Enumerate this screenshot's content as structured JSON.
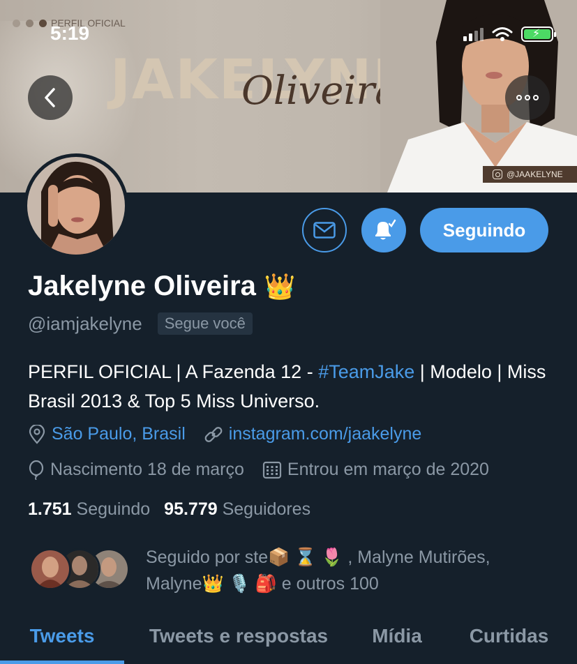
{
  "status_bar": {
    "time": "5:19"
  },
  "banner": {
    "overlay_label": "PERFIL OFICIAL",
    "title": "JAKELYNE",
    "script": "Oliveira",
    "instagram_tag": "@JAAKELYNE"
  },
  "actions": {
    "follow_label": "Seguindo"
  },
  "profile": {
    "name": "Jakelyne Oliveira",
    "name_emoji": "👑",
    "handle": "@iamjakelyne",
    "follows_you": "Segue você",
    "bio_part1": "PERFIL OFICIAL | A Fazenda 12 - ",
    "bio_hashtag": "#TeamJake",
    "bio_part2": " | Modelo | Miss Brasil 2013 & Top 5 Miss Universo.",
    "location": "São Paulo, Brasil",
    "website": "instagram.com/jaakelyne",
    "birthday": "Nascimento 18 de março",
    "joined": "Entrou em março de 2020"
  },
  "stats": {
    "following_count": "1.751",
    "following_label": "Seguindo",
    "followers_count": "95.779",
    "followers_label": "Seguidores"
  },
  "followed_by": {
    "line1": "Seguido por ste📦 ⌛ 🌷 , Malyne Mutirões,",
    "line2": "Malyne👑 🎙️ 🎒  e outros 100"
  },
  "tabs": [
    {
      "label": "Tweets"
    },
    {
      "label": "Tweets e respostas"
    },
    {
      "label": "Mídia"
    },
    {
      "label": "Curtidas"
    }
  ],
  "colors": {
    "accent": "#4a9be8",
    "background": "#15202b",
    "secondary_text": "#8b98a5"
  }
}
